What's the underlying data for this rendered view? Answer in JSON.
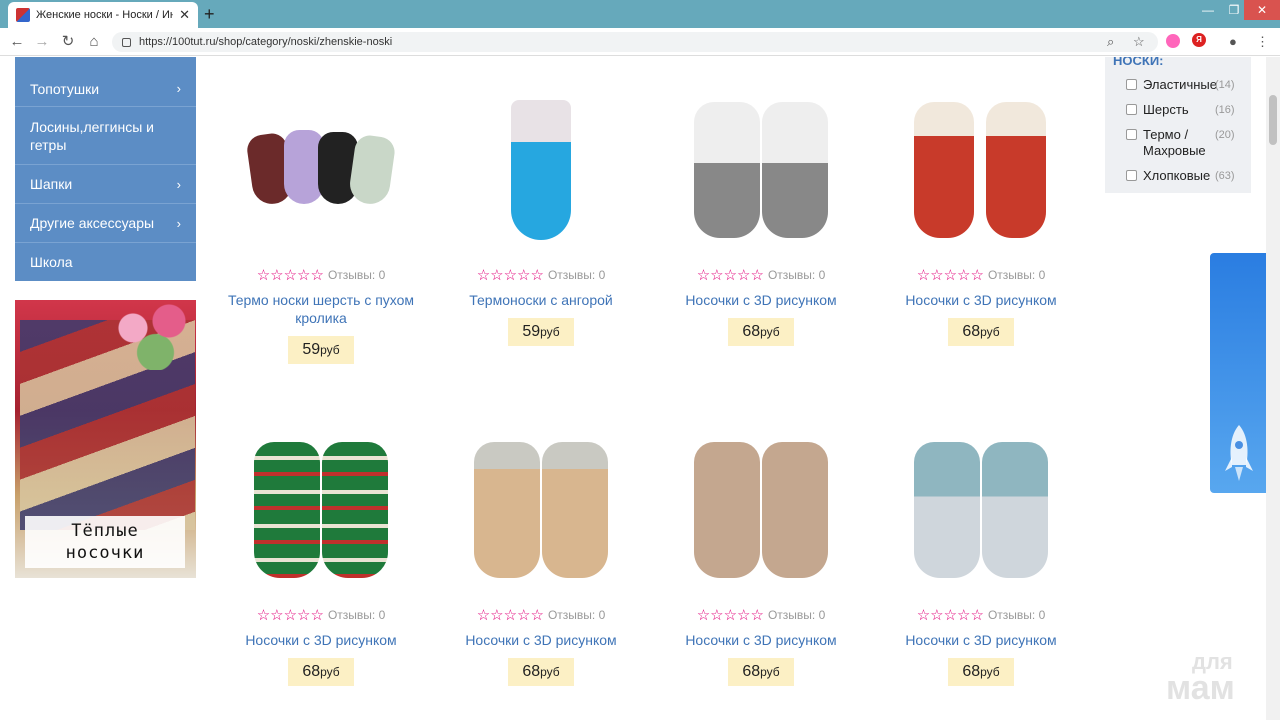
{
  "browser": {
    "tab_title": "Женские носки - Носки / Интер",
    "url": "https://100tut.ru/shop/category/noski/zhenskie-noski",
    "close_tab": "✕",
    "new_tab": "+",
    "win_min": "—",
    "win_max": "❐",
    "win_close": "✕",
    "ext_badge": "Я"
  },
  "sidebar": {
    "items": [
      {
        "label": "Топотушки",
        "chevron": "›"
      },
      {
        "label": "Лосины,леггинсы и гетры",
        "chevron": ""
      },
      {
        "label": "Шапки",
        "chevron": "›"
      },
      {
        "label": "Другие аксессуары",
        "chevron": "›"
      },
      {
        "label": "Школа",
        "chevron": ""
      }
    ]
  },
  "banner": {
    "line1": "Тёплые",
    "line2": "носочки"
  },
  "filter": {
    "title": "НОСКИ:",
    "options": [
      {
        "label": "Эластичные",
        "count": "(14)"
      },
      {
        "label": "Шерсть",
        "count": "(16)"
      },
      {
        "label": "Термо / Махровые",
        "count": "(20)"
      },
      {
        "label": "Хлопковые",
        "count": "(63)"
      }
    ]
  },
  "products": [
    {
      "name": "Термо носки шерсть с пухом кролика",
      "reviews": "Отзывы: 0",
      "price": "59",
      "currency": "руб"
    },
    {
      "name": "Термоноски с ангорой",
      "reviews": "Отзывы: 0",
      "price": "59",
      "currency": "руб"
    },
    {
      "name": "Носочки с 3D рисунком",
      "reviews": "Отзывы: 0",
      "price": "68",
      "currency": "руб"
    },
    {
      "name": "Носочки с 3D рисунком",
      "reviews": "Отзывы: 0",
      "price": "68",
      "currency": "руб"
    },
    {
      "name": "Носочки с 3D рисунком",
      "reviews": "Отзывы: 0",
      "price": "68",
      "currency": "руб"
    },
    {
      "name": "Носочки с 3D рисунком",
      "reviews": "Отзывы: 0",
      "price": "68",
      "currency": "руб"
    },
    {
      "name": "Носочки с 3D рисунком",
      "reviews": "Отзывы: 0",
      "price": "68",
      "currency": "руб"
    },
    {
      "name": "Носочки с 3D рисунком",
      "reviews": "Отзывы: 0",
      "price": "68",
      "currency": "руб"
    }
  ],
  "stars": "☆☆☆☆☆",
  "watermark": {
    "line1": "для",
    "line2": "мам"
  },
  "colors": {
    "accent": "#5c8dc5",
    "link": "#3f74b7",
    "star": "#e2007a",
    "price_bg": "#fcf0c5"
  }
}
